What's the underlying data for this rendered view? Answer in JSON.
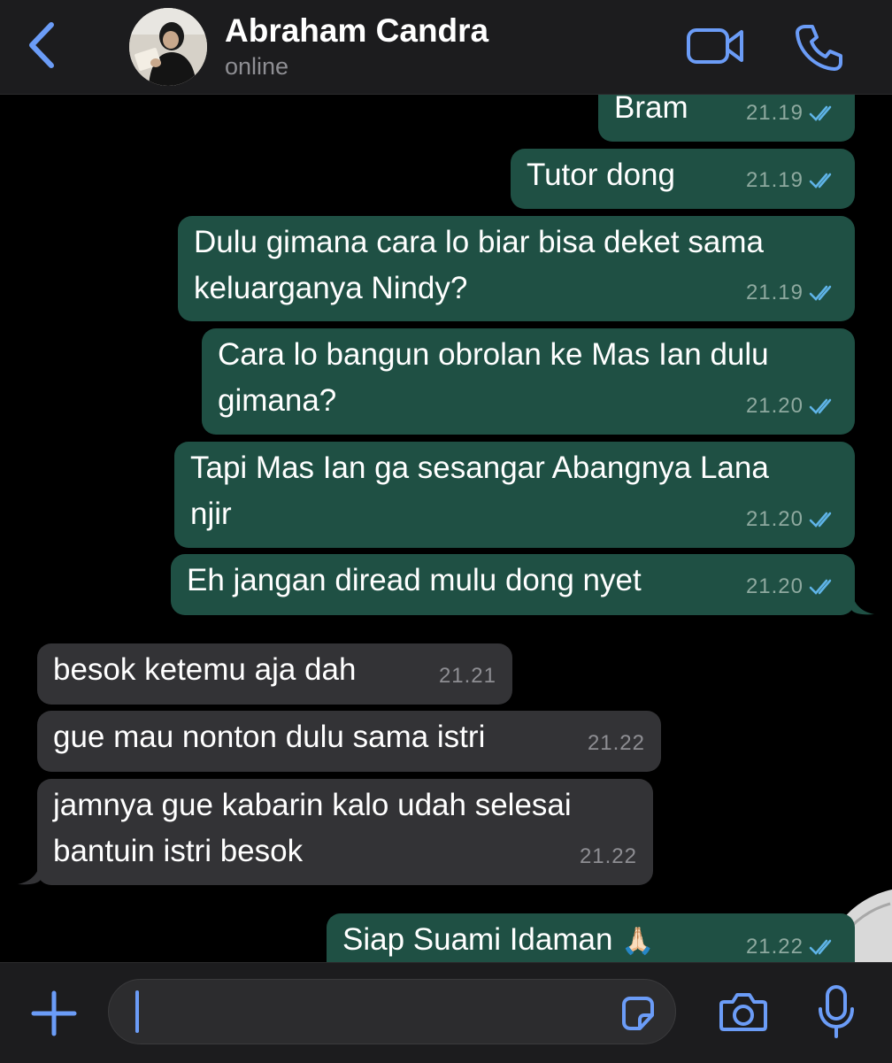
{
  "header": {
    "contact_name": "Abraham Candra",
    "status": "online",
    "icons": [
      "chevron-left-icon",
      "avatar",
      "video-camera-icon",
      "phone-icon"
    ]
  },
  "colors": {
    "accent": "#6b9cf7",
    "outgoing_bubble": "#1f5044",
    "incoming_bubble": "#333336",
    "read_ticks": "#5fb4e8"
  },
  "messages": [
    {
      "direction": "out",
      "text": "Bram",
      "time": "21.19",
      "status": "read"
    },
    {
      "direction": "out",
      "text": "Tutor dong",
      "time": "21.19",
      "status": "read"
    },
    {
      "direction": "out",
      "line1": "Dulu gimana cara lo biar bisa deket sama",
      "line2": "keluarganya Nindy?",
      "time": "21.19",
      "status": "read"
    },
    {
      "direction": "out",
      "line1": "Cara lo bangun obrolan ke Mas Ian dulu",
      "line2": "gimana?",
      "time": "21.20",
      "status": "read"
    },
    {
      "direction": "out",
      "line1": "Tapi Mas Ian ga sesangar Abangnya Lana",
      "line2": "njir",
      "time": "21.20",
      "status": "read"
    },
    {
      "direction": "out",
      "text": "Eh jangan diread mulu dong nyet",
      "time": "21.20",
      "status": "read"
    },
    {
      "direction": "in",
      "text": "besok ketemu aja dah",
      "time": "21.21"
    },
    {
      "direction": "in",
      "text": "gue mau nonton dulu sama istri",
      "time": "21.22"
    },
    {
      "direction": "in",
      "line1": "jamnya gue kabarin kalo udah selesai",
      "line2": "bantuin istri besok",
      "time": "21.22"
    },
    {
      "direction": "out",
      "text": "Siap Suami Idaman",
      "emoji": "🙏🏻",
      "time": "21.22",
      "status": "read"
    }
  ],
  "input": {
    "value": "",
    "icons": [
      "plus-icon",
      "sticker-icon",
      "camera-icon",
      "microphone-icon"
    ]
  }
}
